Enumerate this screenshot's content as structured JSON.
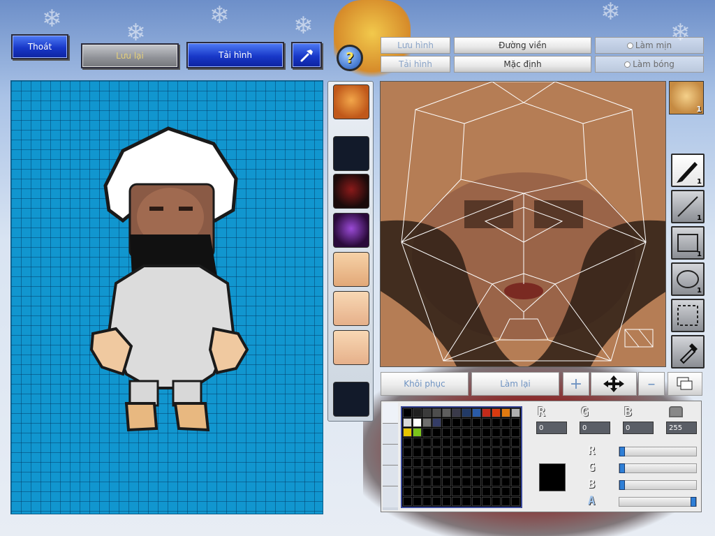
{
  "top_buttons": {
    "exit": "Thoát",
    "save": "Lưu lại",
    "reload": "Tải hình",
    "help": "?"
  },
  "editor_header": {
    "save_image": "Lưu hình",
    "load_image": "Tải hình",
    "outline": "Đường viền",
    "default": "Mặc định",
    "smooth": "Làm mịn",
    "shade": "Làm bóng"
  },
  "face_preview": {
    "count": "1"
  },
  "tools": [
    {
      "name": "pen",
      "count": "1"
    },
    {
      "name": "line",
      "count": "1"
    },
    {
      "name": "rectangle",
      "count": "1"
    },
    {
      "name": "ellipse",
      "count": "1"
    },
    {
      "name": "select",
      "count": ""
    },
    {
      "name": "eyedropper",
      "count": ""
    }
  ],
  "actions": {
    "restore": "Khôi phục",
    "redo": "Làm lại"
  },
  "color": {
    "r": "0",
    "g": "0",
    "b": "0",
    "a": "255",
    "current_hex": "#000000",
    "labels": {
      "r": "R",
      "g": "G",
      "b": "B",
      "a": "A"
    }
  },
  "palette_top_row": [
    "#000000",
    "#1f1f1f",
    "#3b3b3b",
    "#4d4d4d",
    "#5e5e5e",
    "#3a3a4a",
    "#223a66",
    "#2a5ba8",
    "#c22a1a",
    "#d83a10",
    "#e07a10",
    "#b0b0b0"
  ],
  "palette_second_row": [
    "#d8d8d8",
    "#ffffff",
    "#6e6e6e",
    "#343c66",
    "#000000",
    "#000000",
    "#000000",
    "#000000",
    "#000000",
    "#000000",
    "#000000",
    "#000000"
  ],
  "palette_third_row": [
    "#e6c400",
    "#7ac41a",
    "#000000",
    "#000000",
    "#000000",
    "#000000",
    "#000000",
    "#000000",
    "#000000",
    "#000000",
    "#000000",
    "#000000"
  ]
}
